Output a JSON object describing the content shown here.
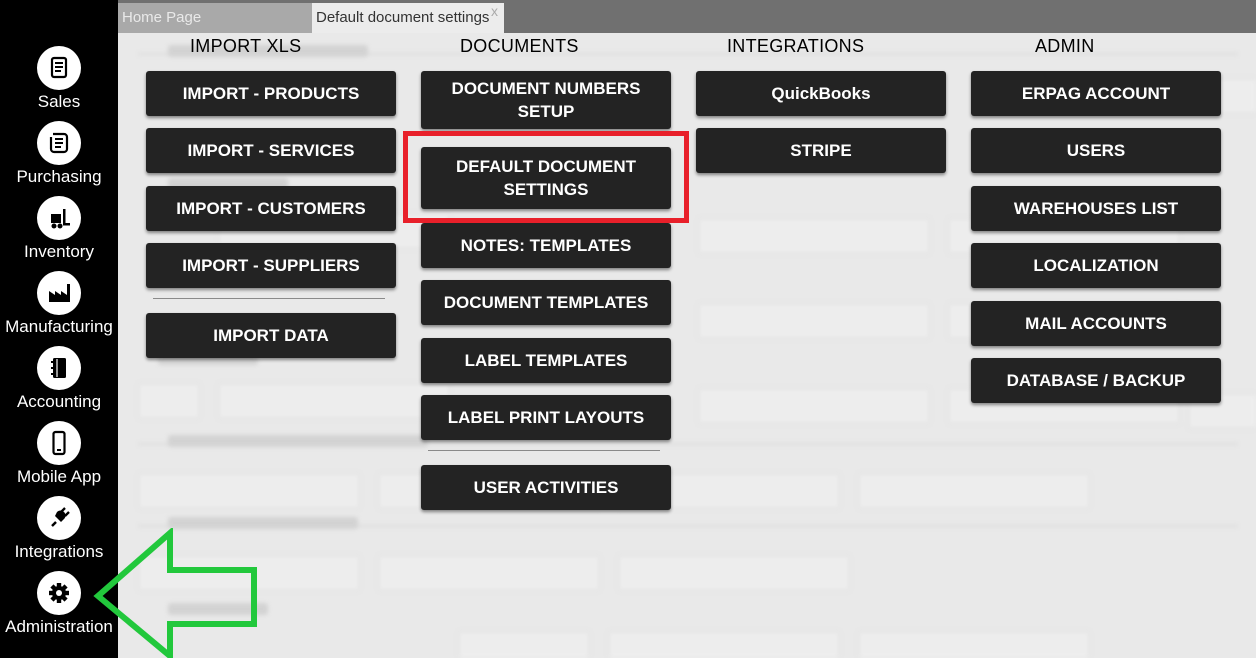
{
  "sidebar": {
    "items": [
      {
        "label": "Sales",
        "icon": "document-icon"
      },
      {
        "label": "Purchasing",
        "icon": "scroll-icon"
      },
      {
        "label": "Inventory",
        "icon": "forklift-icon"
      },
      {
        "label": "Manufacturing",
        "icon": "factory-icon"
      },
      {
        "label": "Accounting",
        "icon": "ledger-icon"
      },
      {
        "label": "Mobile App",
        "icon": "phone-icon"
      },
      {
        "label": "Integrations",
        "icon": "plug-icon"
      },
      {
        "label": "Administration",
        "icon": "gear-icon"
      }
    ]
  },
  "tabs": {
    "home": "Home Page",
    "active": "Default document settings",
    "close": "x"
  },
  "menu": {
    "import_xls": {
      "title": "IMPORT XLS",
      "items": [
        "IMPORT - PRODUCTS",
        "IMPORT - SERVICES",
        "IMPORT - CUSTOMERS",
        "IMPORT - SUPPLIERS"
      ],
      "extra": "IMPORT DATA"
    },
    "documents": {
      "title": "DOCUMENTS",
      "items": [
        "DOCUMENT NUMBERS SETUP",
        "DEFAULT DOCUMENT SETTINGS",
        "NOTES: TEMPLATES",
        "DOCUMENT TEMPLATES",
        "LABEL TEMPLATES",
        "LABEL PRINT LAYOUTS"
      ],
      "extra": "USER ACTIVITIES"
    },
    "integrations": {
      "title": "INTEGRATIONS",
      "items": [
        "QuickBooks",
        "STRIPE"
      ]
    },
    "admin": {
      "title": "ADMIN",
      "items": [
        "ERPAG ACCOUNT",
        "USERS",
        "WAREHOUSES LIST",
        "LOCALIZATION",
        "MAIL ACCOUNTS",
        "DATABASE / BACKUP"
      ]
    }
  },
  "annotations": {
    "highlight_color": "#e8202a",
    "arrow_color": "#22c83c"
  }
}
